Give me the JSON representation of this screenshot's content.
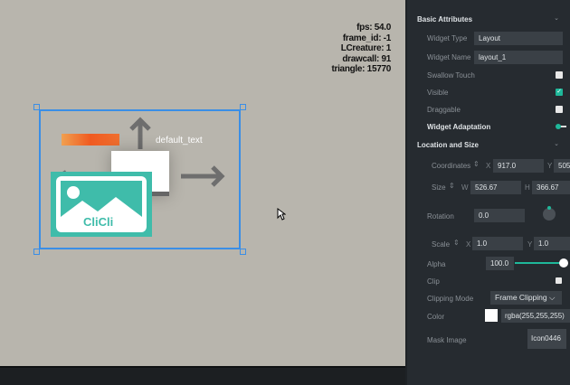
{
  "stats": {
    "fps": "fps: 54.0",
    "frame_id": "frame_id: -1",
    "lcreature": "LCreature: 1",
    "drawcall": "drawcall: 91",
    "triangle": "triangle: 15770"
  },
  "scene": {
    "default_text": "default_text",
    "logo_text": "CliCli"
  },
  "panel": {
    "basic_header": "Basic Attributes",
    "widget_type_label": "Widget Type",
    "widget_type": "Layout",
    "widget_name_label": "Widget Name",
    "widget_name": "layout_1",
    "swallow_touch_label": "Swallow Touch",
    "swallow_touch": false,
    "visible_label": "Visible",
    "visible": true,
    "draggable_label": "Draggable",
    "draggable": false,
    "adaptation_label": "Widget Adaptation",
    "adaptation": true,
    "location_header": "Location and Size",
    "coordinates_label": "Coordinates",
    "x_label": "X",
    "x": "917.0",
    "y_label": "Y",
    "y": "505.",
    "size_label": "Size",
    "w_label": "W",
    "w": "526.67",
    "h_label": "H",
    "h": "366.67",
    "rotation_label": "Rotation",
    "rotation": "0.0",
    "scale_label": "Scale",
    "sx_label": "X",
    "sx": "1.0",
    "sy_label": "Y",
    "sy": "1.0",
    "alpha_label": "Alpha",
    "alpha": "100.0",
    "alpha_fraction": 1.0,
    "clip_label": "Clip",
    "clip": false,
    "clipping_mode_label": "Clipping Mode",
    "clipping_mode": "Frame Clipping",
    "color_label": "Color",
    "color": "rgba(255,255,255)",
    "mask_label": "Mask Image",
    "mask": "Icon0446"
  },
  "colors": {
    "accent": "#1fb89a",
    "selection": "#3a8ee6"
  }
}
